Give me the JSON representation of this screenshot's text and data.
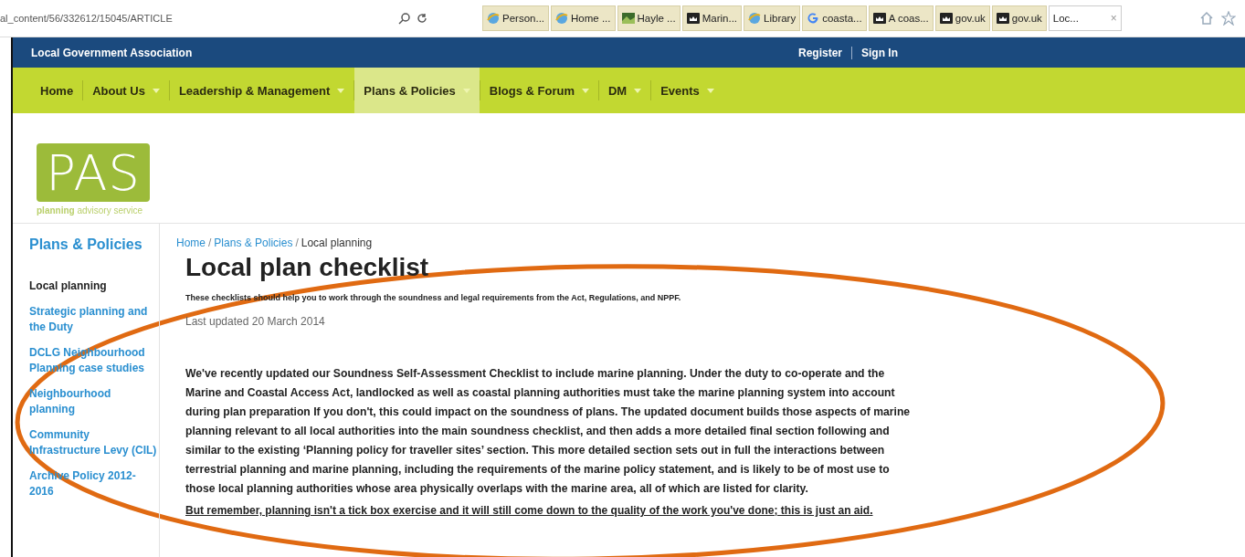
{
  "browser": {
    "address": "al_content/56/332612/15045/ARTICLE",
    "tabs": [
      {
        "kind": "browser",
        "title": "Person...",
        "selected": false
      },
      {
        "kind": "browser",
        "title": "Home ...",
        "selected": false
      },
      {
        "kind": "photo",
        "title": "Hayle ...",
        "selected": false
      },
      {
        "kind": "crest",
        "title": "Marin...",
        "selected": false
      },
      {
        "kind": "browser",
        "title": "Library",
        "selected": false
      },
      {
        "kind": "google",
        "title": "coasta...",
        "selected": false
      },
      {
        "kind": "crest",
        "title": "A coas...",
        "selected": false
      },
      {
        "kind": "crest",
        "title": "gov.uk",
        "selected": false
      },
      {
        "kind": "crest",
        "title": "gov.uk",
        "selected": false
      },
      {
        "kind": "plain",
        "title": "Loc...",
        "selected": true
      }
    ],
    "close": "×"
  },
  "topbar": {
    "org": "Local Government Association",
    "links": [
      "Register",
      "Sign In"
    ]
  },
  "nav": [
    {
      "label": "Home",
      "dropdown": false,
      "selected": false
    },
    {
      "label": "About Us",
      "dropdown": true,
      "selected": false
    },
    {
      "label": "Leadership & Management",
      "dropdown": true,
      "selected": false
    },
    {
      "label": "Plans & Policies",
      "dropdown": true,
      "selected": true
    },
    {
      "label": "Blogs & Forum",
      "dropdown": true,
      "selected": false
    },
    {
      "label": "DM",
      "dropdown": true,
      "selected": false
    },
    {
      "label": "Events",
      "dropdown": true,
      "selected": false
    }
  ],
  "logo": {
    "mark": "PAS",
    "tagline_bold": "planning",
    "tagline": "advisory service"
  },
  "sidebar": {
    "title": "Plans & Policies",
    "items": [
      {
        "label": "Local planning",
        "selected": true
      },
      {
        "label": "Strategic planning and the Duty",
        "selected": false
      },
      {
        "label": "DCLG Neighbourhood Planning case studies",
        "selected": false
      },
      {
        "label": "Neighbourhood planning",
        "selected": false
      },
      {
        "label": "Community Infrastructure Levy (CIL)",
        "selected": false
      },
      {
        "label": "Archive Policy 2012-2016",
        "selected": false
      }
    ]
  },
  "breadcrumb": [
    {
      "label": "Home",
      "link": true
    },
    {
      "separator": "/",
      "label": "Plans & Policies",
      "link": true
    },
    {
      "separator": "/",
      "label": "Local planning",
      "link": false
    }
  ],
  "article": {
    "title": "Local plan checklist",
    "intro": "These checklists should help you to work through the soundness and legal requirements from the Act, Regulations, and NPPF.",
    "updated": "Last updated 20 March 2014",
    "body": "We've recently updated our Soundness Self-Assessment Checklist to include marine planning. Under the duty to co-operate and the Marine and Coastal Access Act, landlocked as well as coastal planning authorities must take the marine planning system into account during plan preparation If you don't, this could impact on the soundness of plans. The updated document builds those aspects of marine planning relevant to all local authorities into the main soundness checklist, and then adds a more detailed final section following and similar to the existing ‘Planning policy for traveller sites’ section. This more detailed section sets out in full the interactions between terrestrial planning and marine planning, including the requirements of the marine policy statement, and is likely to be of most use to those local planning authorities whose area physically overlaps with the marine area, all of which are listed for clarity.",
    "note": "But remember, planning isn't a tick box exercise and it will still come down to the quality of the work you've done; this is just an aid."
  },
  "annotation": {
    "kind": "ellipse",
    "color": "#e06a12"
  }
}
